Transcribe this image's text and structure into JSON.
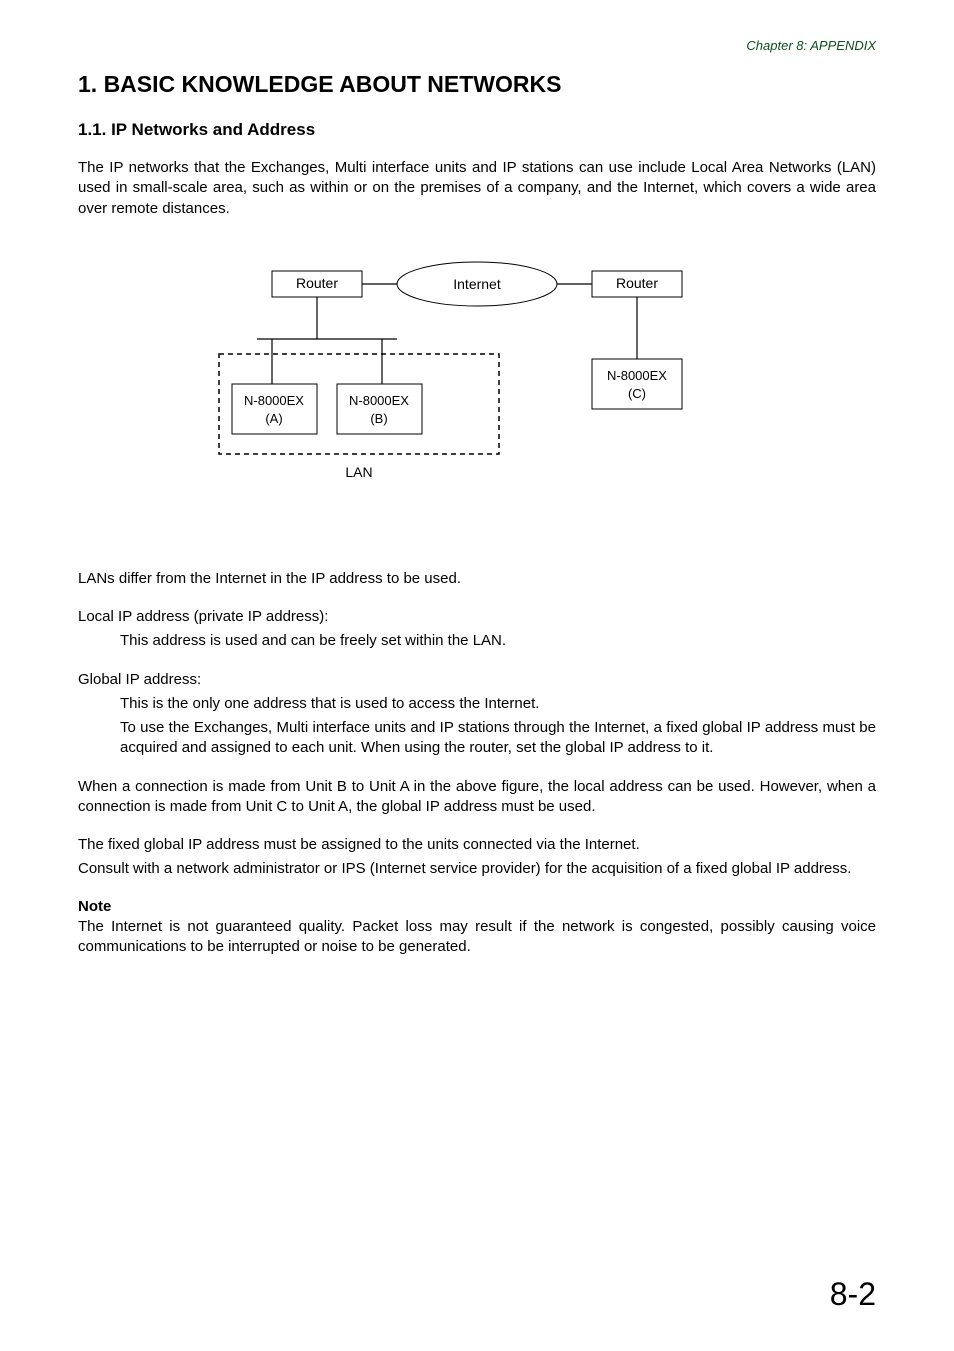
{
  "chapter": "Chapter 8:  APPENDIX",
  "h1": "1. BASIC KNOWLEDGE ABOUT NETWORKS",
  "h2": "1.1. IP Networks and Address",
  "intro": "The IP networks that the Exchanges, Multi interface units and IP stations can use include Local Area Networks (LAN) used in small-scale area, such as within or on the premises of a company, and the Internet, which covers a wide area over remote distances.",
  "diagram": {
    "router_left": "Router",
    "internet": "Internet",
    "router_right": "Router",
    "box_a_line1": "N-8000EX",
    "box_a_line2": "(A)",
    "box_b_line1": "N-8000EX",
    "box_b_line2": "(B)",
    "box_c_line1": "N-8000EX",
    "box_c_line2": "(C)",
    "lan_label": "LAN"
  },
  "body": {
    "lan_diff": "LANs differ from the Internet in the IP address to be used.",
    "local_label": "Local IP address (private IP address):",
    "local_text": "This address is used and can be freely set within the LAN.",
    "global_label": "Global IP address:",
    "global_text1": "This is the only one address that is used to access the Internet.",
    "global_text2": "To use the Exchanges, Multi interface units and IP stations through the Internet, a fixed global IP address must be acquired and assigned to each unit. When using the router, set the global IP address to it.",
    "conn1": "When a connection is made from Unit B to Unit A in the above figure, the local address can be used. However, when a connection is made from Unit C to Unit A, the global IP address must be used.",
    "fixed1": "The fixed global IP address must be assigned to the units connected via the Internet.",
    "fixed2": "Consult with a network administrator or IPS (Internet service provider) for the acquisition of a fixed global IP address.",
    "note_label": "Note",
    "note_text": "The Internet is not guaranteed quality. Packet loss may result if the network is congested, possibly causing voice communications to be interrupted or noise to be generated."
  },
  "page_num": "8-2"
}
